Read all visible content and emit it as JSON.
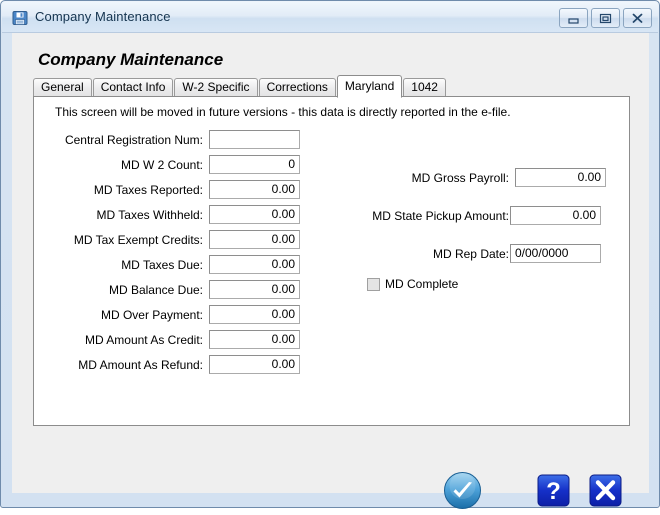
{
  "window": {
    "title": "Company Maintenance",
    "icon": "floppy-disk-save-icon",
    "controls": {
      "minimize": "Minimize",
      "maximize": "Maximize",
      "close": "Close"
    }
  },
  "page": {
    "heading": "Company Maintenance"
  },
  "tabs": [
    {
      "label": "General",
      "active": false
    },
    {
      "label": "Contact Info",
      "active": false
    },
    {
      "label": "W-2 Specific",
      "active": false
    },
    {
      "label": "Corrections",
      "active": false
    },
    {
      "label": "Maryland",
      "active": true
    },
    {
      "label": "1042",
      "active": false
    }
  ],
  "panel": {
    "notice": "This screen will be moved in future versions - this data is directly reported in the e-file.",
    "left_fields": [
      {
        "label": "Central Registration Num:",
        "value": "",
        "align": "left"
      },
      {
        "label": "MD W 2 Count:",
        "value": "0",
        "align": "right"
      },
      {
        "label": "MD Taxes Reported:",
        "value": "0.00",
        "align": "right"
      },
      {
        "label": "MD Taxes Withheld:",
        "value": "0.00",
        "align": "right"
      },
      {
        "label": "MD Tax Exempt Credits:",
        "value": "0.00",
        "align": "right"
      },
      {
        "label": "MD Taxes Due:",
        "value": "0.00",
        "align": "right"
      },
      {
        "label": "MD Balance Due:",
        "value": "0.00",
        "align": "right"
      },
      {
        "label": "MD Over Payment:",
        "value": "0.00",
        "align": "right"
      },
      {
        "label": "MD Amount As Credit:",
        "value": "0.00",
        "align": "right"
      },
      {
        "label": "MD Amount As Refund:",
        "value": "0.00",
        "align": "right"
      }
    ],
    "right_fields": [
      {
        "label": "MD Gross Payroll:",
        "value": "0.00",
        "align": "right"
      },
      {
        "label": "MD State Pickup Amount:",
        "value": "0.00",
        "align": "right"
      },
      {
        "label": "MD Rep Date:",
        "value": "0/00/0000",
        "align": "left"
      }
    ],
    "checkbox": {
      "label": "MD Complete",
      "checked": false
    }
  },
  "actions": [
    {
      "name": "ok",
      "icon": "blue-circle-checkmark-icon",
      "tooltip": "OK"
    },
    {
      "name": "help",
      "icon": "blue-square-question-mark-icon",
      "tooltip": "Help"
    },
    {
      "name": "close",
      "icon": "blue-square-x-icon",
      "tooltip": "Close"
    }
  ],
  "colors": {
    "accent": "#1f4fd8",
    "ok_blue": "#3f9bd8",
    "title_text": "#15344f",
    "panel_bg": "#ffffff",
    "client_bg": "#efefef"
  }
}
